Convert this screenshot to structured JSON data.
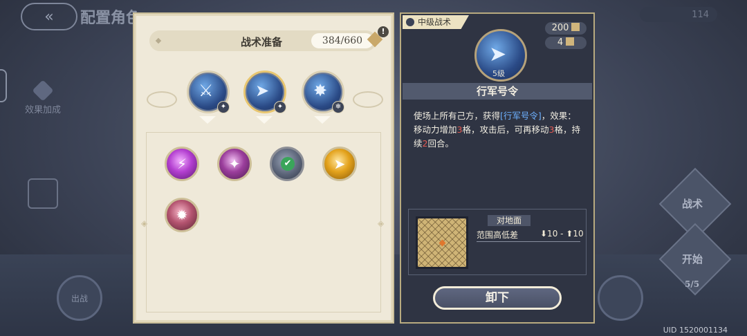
{
  "background": {
    "title": "配置角色",
    "effect_label": "效果加成",
    "tactic_label": "战术",
    "start_label": "开始",
    "deploy_label": "出战",
    "count_label": "5/5",
    "top_pill": "114",
    "uid": "UID 1520001134"
  },
  "left_panel": {
    "title": "战术准备",
    "points": "384/660",
    "alert": "!",
    "selected": [
      {
        "name": "equipped-skill-1",
        "badge": "✦"
      },
      {
        "name": "equipped-skill-2",
        "badge": "✦"
      },
      {
        "name": "equipped-skill-3",
        "badge": "❄"
      }
    ],
    "skills": [
      {
        "glyph": "⚡",
        "color": "purple"
      },
      {
        "glyph": "✦",
        "color": "purple"
      },
      {
        "glyph": "➤",
        "color": "gray",
        "checked": true
      },
      {
        "glyph": "➤",
        "color": "gold"
      },
      {
        "glyph": "✹",
        "color": "rose"
      }
    ]
  },
  "right_panel": {
    "tag": "中级战术",
    "level": "5级",
    "cost": "200",
    "count": "4",
    "name": "行军号令",
    "desc_parts": {
      "p1": "使场上所有己方，获得",
      "link": "[行军号令]",
      "p2": "，效果：移动力增加",
      "n1": "3",
      "p3": "格，攻击后，可再移动",
      "n2": "3",
      "p4": "格，持续",
      "n3": "2",
      "p5": "回合。"
    },
    "target": "对地面",
    "height_label": "范围高低差",
    "height_value": "⬇10 - ⬆10",
    "unequip_button": "卸下"
  },
  "colors": {
    "panel_bg": "#efe9d9",
    "detail_bg": "#2f3443",
    "highlight_blue": "#6db1ff",
    "highlight_red": "#e35a52"
  }
}
